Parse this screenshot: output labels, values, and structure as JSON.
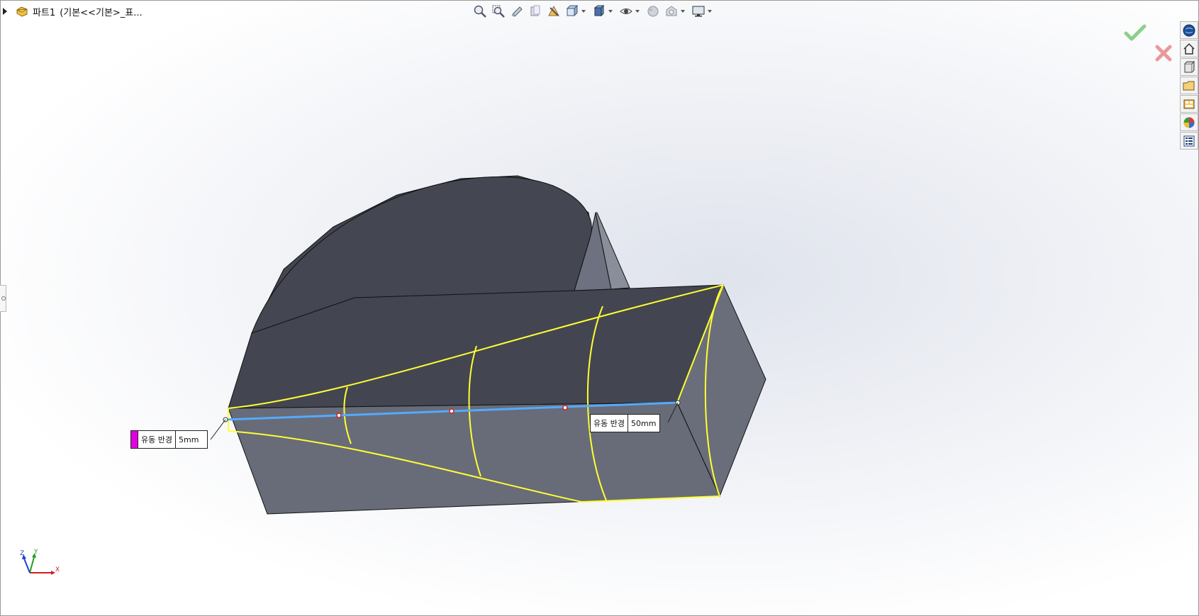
{
  "feature_tree": {
    "part_name": "파트1",
    "config": "(기본<<기본>_표..."
  },
  "callouts": [
    {
      "label": "유동 반경",
      "value": "5mm"
    },
    {
      "label": "유동 반경",
      "value": "50mm"
    }
  ],
  "triad": {
    "z": "Z",
    "y": "Y",
    "x": "X"
  },
  "colors": {
    "selection_edge": "#ffff33",
    "centerline": "#55aaff",
    "body": "#434650",
    "face_light": "#686c78"
  }
}
